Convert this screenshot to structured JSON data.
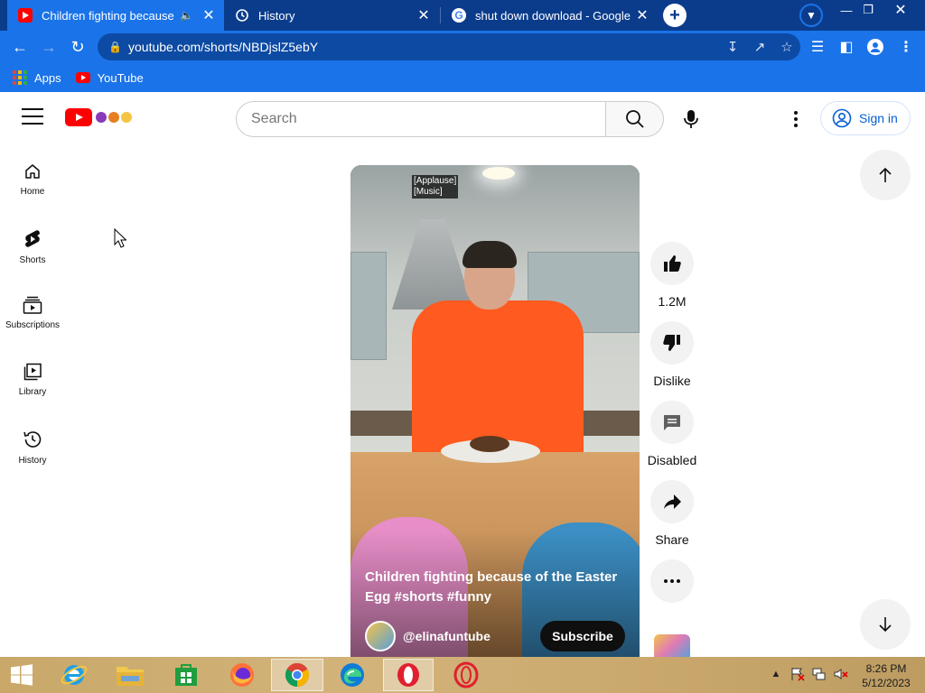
{
  "browser": {
    "tabs": [
      {
        "title": "Children fighting because of the Easter Egg #shorts #funny",
        "favicon": "youtube-icon",
        "audio": true
      },
      {
        "title": "History",
        "favicon": "history-icon"
      },
      {
        "title": "shut down download - Google Search",
        "favicon": "google-icon"
      }
    ],
    "url": "youtube.com/shorts/NBDjslZ5ebY",
    "bookmarks": [
      {
        "label": "Apps",
        "icon": "apps-grid-icon"
      },
      {
        "label": "YouTube",
        "icon": "youtube-icon"
      }
    ],
    "colors": {
      "frame": "#0b3c8c",
      "toolbar": "#1a73e8"
    }
  },
  "youtube": {
    "search_placeholder": "Search",
    "sign_in": "Sign in",
    "sidebar": [
      {
        "label": "Home",
        "icon": "home-icon"
      },
      {
        "label": "Shorts",
        "icon": "shorts-icon"
      },
      {
        "label": "Subscriptions",
        "icon": "subscriptions-icon"
      },
      {
        "label": "Library",
        "icon": "library-icon"
      },
      {
        "label": "History",
        "icon": "history-icon"
      }
    ],
    "short": {
      "captions": [
        "[Applause]",
        "[Music]"
      ],
      "title": "Children fighting because of the Easter Egg #shorts #funny",
      "channel": "@elinafuntube",
      "subscribe": "Subscribe"
    },
    "actions": [
      {
        "label": "1.2M",
        "icon": "thumbs-up-icon"
      },
      {
        "label": "Dislike",
        "icon": "thumbs-down-icon"
      },
      {
        "label": "Disabled",
        "icon": "comments-icon"
      },
      {
        "label": "Share",
        "icon": "share-icon"
      },
      {
        "label": "",
        "icon": "more-horizontal-icon"
      }
    ],
    "brand_color": "#ff0000",
    "link_color": "#065fd4"
  },
  "taskbar": {
    "apps": [
      "start",
      "internet-explorer",
      "file-explorer",
      "store",
      "firefox",
      "chrome",
      "edge",
      "opera",
      "opera-gx"
    ],
    "clock": {
      "time": "8:26 PM",
      "date": "5/12/2023"
    }
  }
}
